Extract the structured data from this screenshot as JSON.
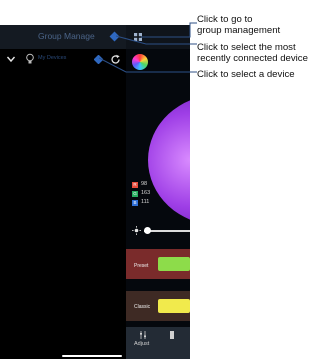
{
  "drawer": {
    "title": "Group Manage",
    "device_label": "My Devices"
  },
  "panel": {
    "rgb": [
      {
        "letter": "R",
        "value": "98",
        "color": "#e74c3c"
      },
      {
        "letter": "G",
        "value": "163",
        "color": "#27ae60"
      },
      {
        "letter": "B",
        "value": "111",
        "color": "#2f6fd6"
      }
    ],
    "modes": [
      {
        "label": "Preset",
        "swatch_color": "#8ddc4a"
      },
      {
        "label": "Classic",
        "swatch_color": "#f1ea4c"
      }
    ],
    "tabbar": {
      "adjust_label": "Adjust"
    }
  },
  "callouts": {
    "group_management": "Click to go to group management",
    "recent_device": "Click to select the most recently connected device",
    "select_device": "Click to select a device"
  },
  "colors": {
    "callout_line": "#2c4f86",
    "header_text": "#4b6488",
    "accent_blue": "#2f68c0"
  }
}
